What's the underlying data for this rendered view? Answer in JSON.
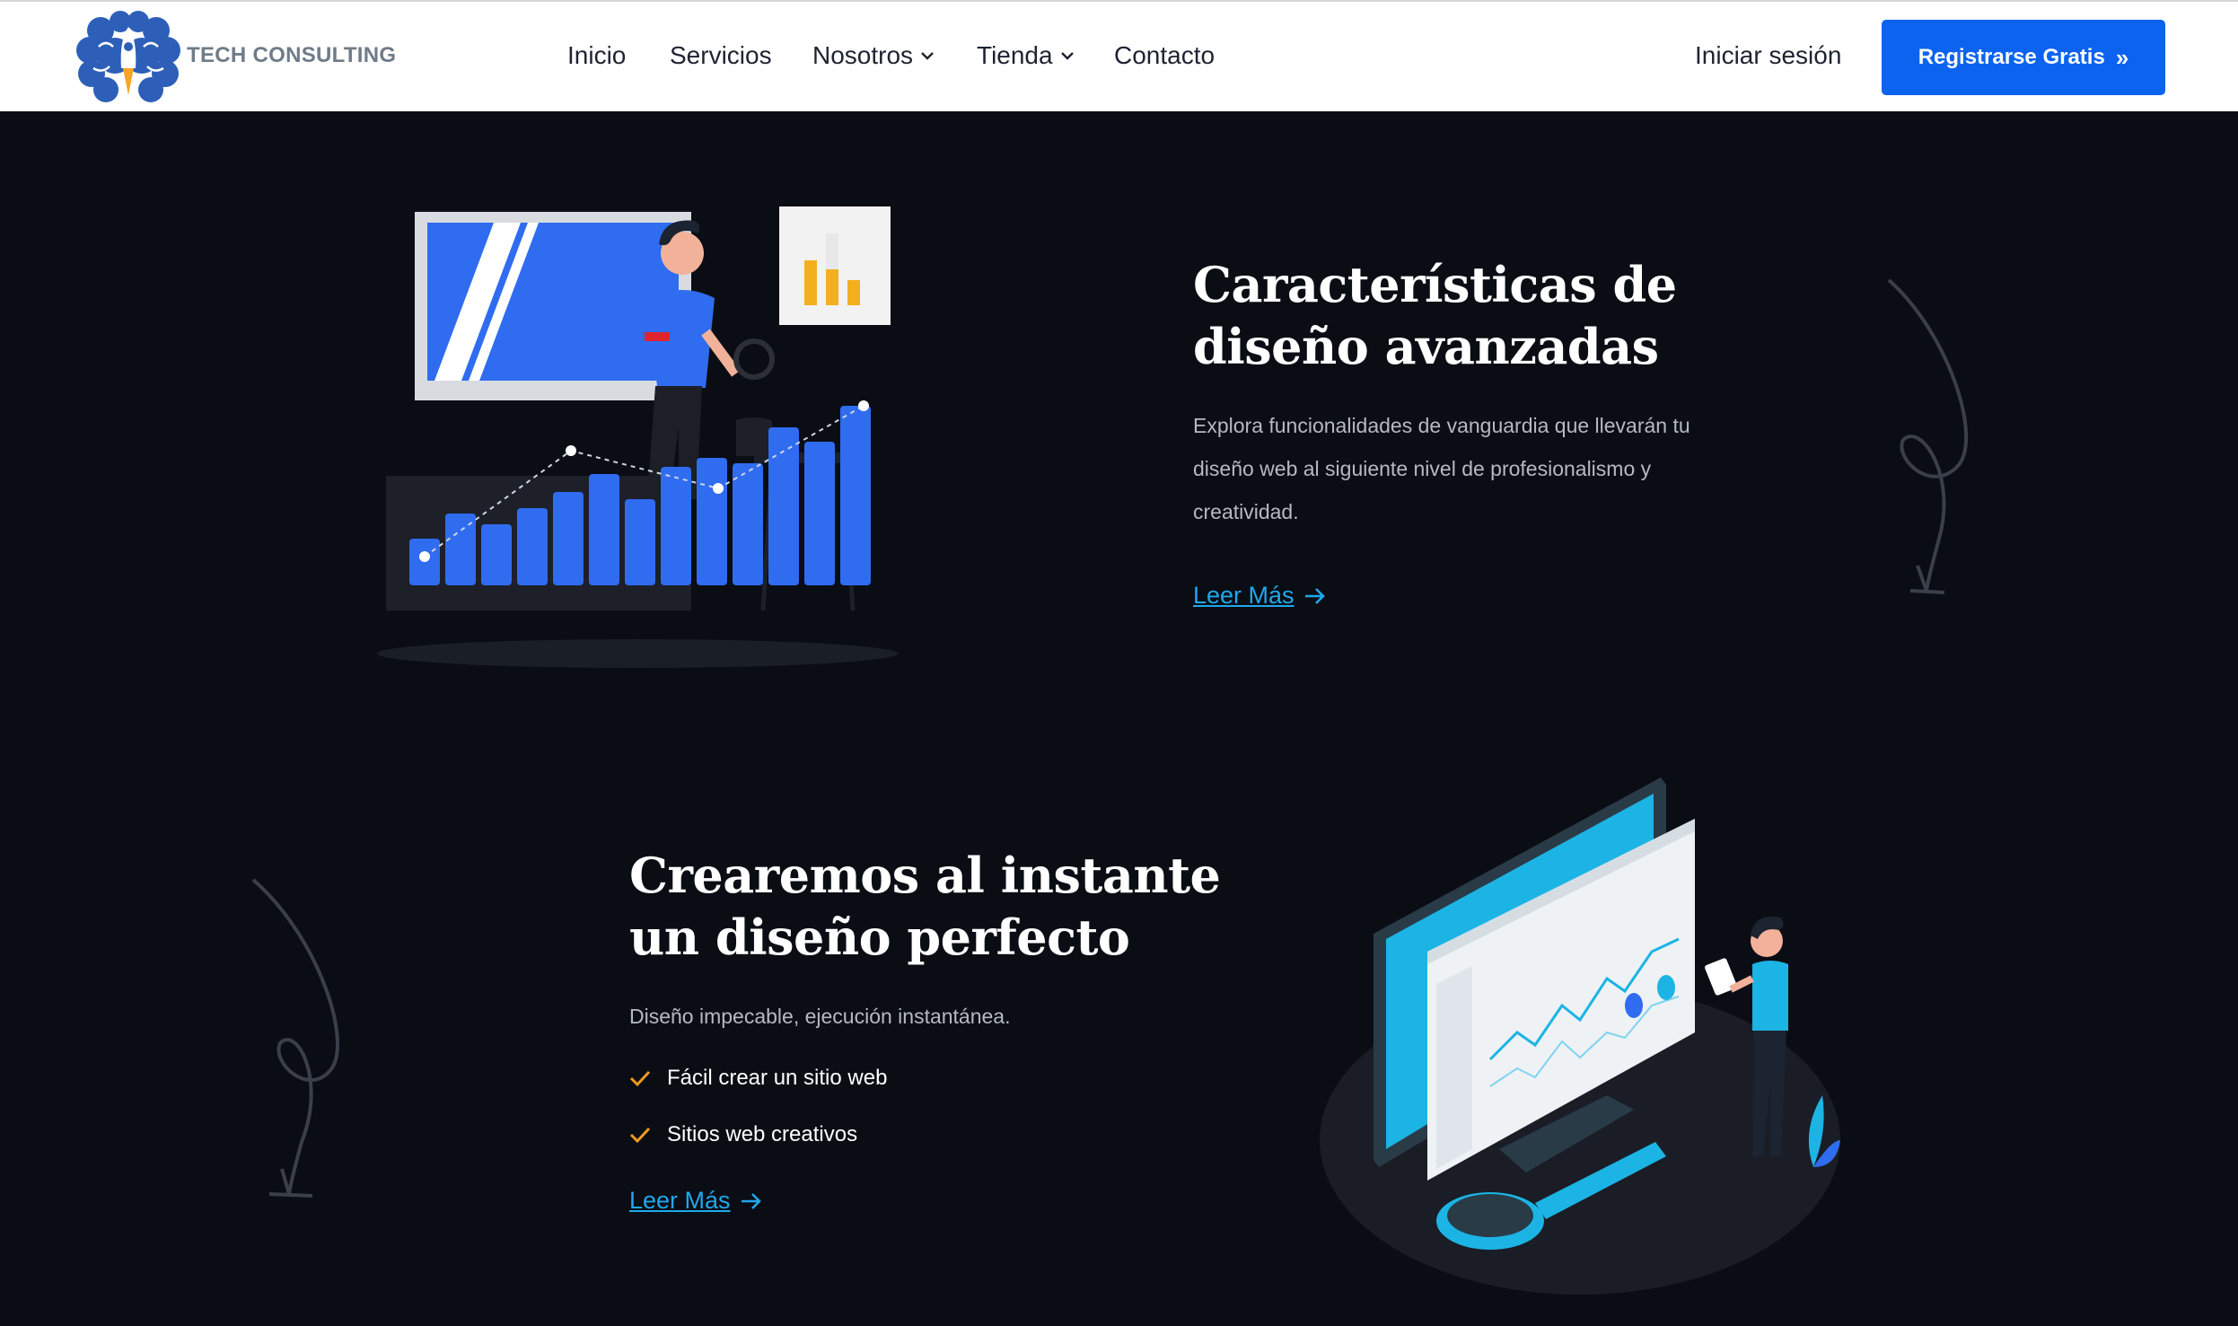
{
  "header": {
    "brand": "TECH CONSULTING",
    "nav": [
      {
        "label": "Inicio",
        "dropdown": false
      },
      {
        "label": "Servicios",
        "dropdown": false
      },
      {
        "label": "Nosotros",
        "dropdown": true
      },
      {
        "label": "Tienda",
        "dropdown": true
      },
      {
        "label": "Contacto",
        "dropdown": false
      }
    ],
    "login_label": "Iniciar sesión",
    "cta_label": "Registrarse Gratis"
  },
  "section1": {
    "title_line1": "Características de",
    "title_line2": "diseño avanzadas",
    "description_line1": "Explora funcionalidades de vanguardia que llevarán tu",
    "description_line2": "diseño web al siguiente nivel de profesionalismo y",
    "description_line3": "creatividad.",
    "read_more": "Leer Más"
  },
  "section2": {
    "title_line1": "Crearemos al instante",
    "title_line2": "un diseño perfecto",
    "description": "Diseño impecable, ejecución instantánea.",
    "checklist": [
      "Fácil crear un sitio web",
      "Sitios web creativos"
    ],
    "read_more": "Leer Más"
  },
  "colors": {
    "background": "#0a0d14",
    "primary_button": "#0b63f0",
    "link": "#1fa8ec",
    "check": "#f29a1e",
    "illustration_blue": "#2f6cf0",
    "illustration_cyan": "#1cb4e4"
  },
  "icons": {
    "logo": "brain-rocket-icon",
    "dropdown": "chevron-down-icon",
    "cta": "double-chevron-right-icon",
    "read_more": "arrow-right-icon",
    "checklist": "check-icon"
  }
}
